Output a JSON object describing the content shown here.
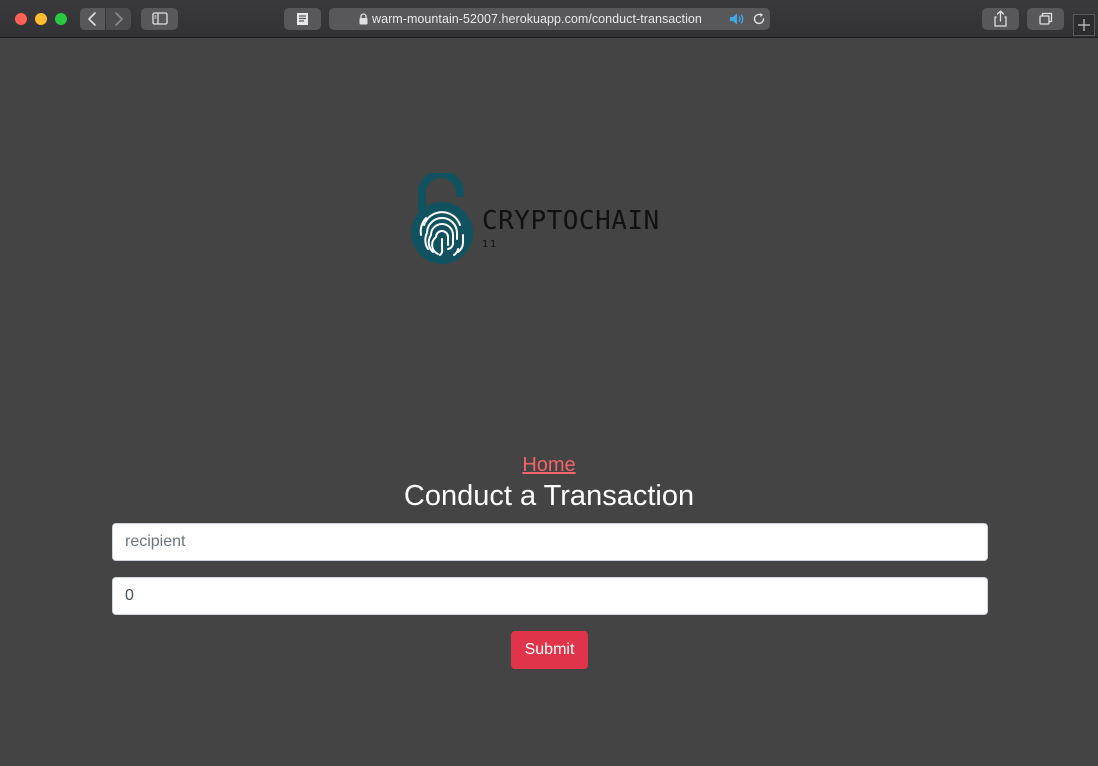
{
  "browser": {
    "url": "warm-mountain-52007.herokuapp.com/conduct-transaction",
    "icons": {
      "close": "close-icon",
      "minimize": "minimize-icon",
      "maximize": "maximize-icon",
      "back": "chevron-left-icon",
      "forward": "chevron-right-icon",
      "sidebar": "sidebar-icon",
      "reader": "reader-icon",
      "lock": "lock-icon",
      "audio": "speaker-icon",
      "reload": "reload-icon",
      "share": "share-icon",
      "tabs": "tabs-icon",
      "new_tab": "plus-icon"
    }
  },
  "logo": {
    "title": "CRYPTOCHAIN",
    "subtitle": "11",
    "icon": "fingerprint-lock-icon"
  },
  "nav": {
    "home_label": "Home"
  },
  "form": {
    "heading": "Conduct a Transaction",
    "recipient_placeholder": "recipient",
    "amount_value": "0",
    "submit_label": "Submit"
  },
  "colors": {
    "page_background": "#444444",
    "link": "#f2646a",
    "submit": "#e0344a",
    "logo_teal": "#115260"
  }
}
